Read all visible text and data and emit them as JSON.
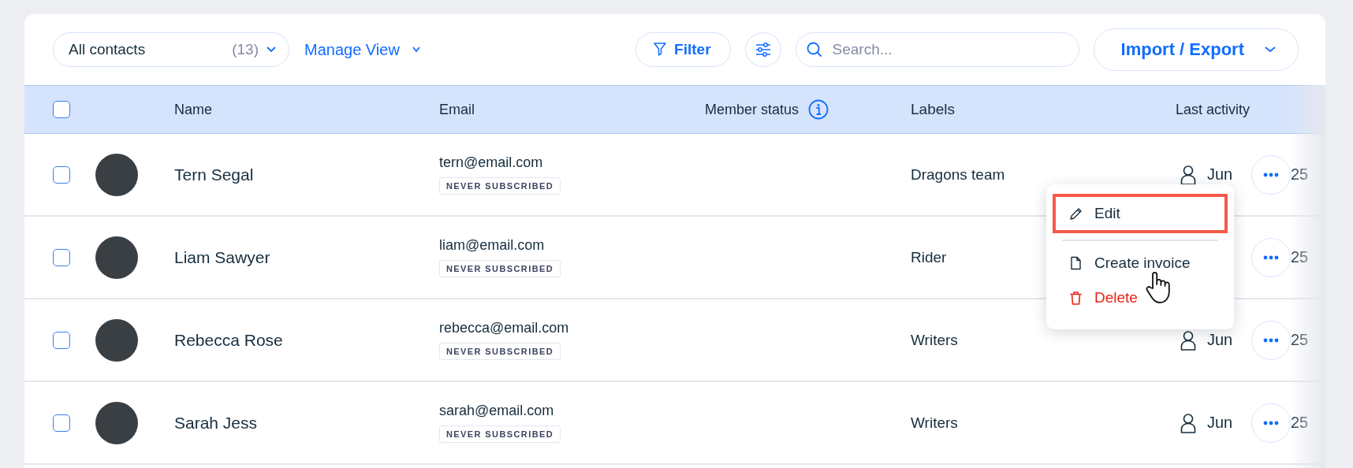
{
  "toolbar": {
    "view_select": {
      "label": "All contacts",
      "count": "(13)"
    },
    "manage_view": "Manage View",
    "filter": "Filter",
    "search": {
      "placeholder": "Search..."
    },
    "import_export": "Import / Export"
  },
  "table": {
    "select_all": {
      "checked": false
    },
    "columns": [
      {
        "label": "Name",
        "kind": "plain"
      },
      {
        "label": "Email",
        "kind": "plain"
      },
      {
        "label": "Member status",
        "kind": "info"
      },
      {
        "label": "Labels",
        "kind": "plain"
      },
      {
        "label": "Last activity",
        "kind": "plain"
      }
    ],
    "rows": [
      {
        "checked": false,
        "name": "Tern Segal",
        "email": "tern@email.com",
        "subscription": "NEVER SUBSCRIBED",
        "label": "Dragons team",
        "activity_start": "Jun",
        "activity_end": "25"
      },
      {
        "checked": false,
        "name": "Liam Sawyer",
        "email": "liam@email.com",
        "subscription": "NEVER SUBSCRIBED",
        "label": "Rider",
        "activity_end": "25"
      },
      {
        "checked": false,
        "name": "Rebecca Rose",
        "email": "rebecca@email.com",
        "subscription": "NEVER SUBSCRIBED",
        "label": "Writers",
        "activity_start": "Jun",
        "activity_end": "25"
      },
      {
        "checked": false,
        "name": "Sarah Jess",
        "email": "sarah@email.com",
        "subscription": "NEVER SUBSCRIBED",
        "label": "Writers",
        "activity_start": "Jun",
        "activity_end": "25"
      }
    ]
  },
  "context_menu": {
    "sections": [
      [
        {
          "kind": "edit",
          "label": "Edit",
          "highlighted": true
        }
      ],
      [
        {
          "kind": "document",
          "label": "Create invoice",
          "highlighted": false
        },
        {
          "kind": "delete",
          "label": "Delete",
          "highlighted": false
        }
      ]
    ]
  }
}
